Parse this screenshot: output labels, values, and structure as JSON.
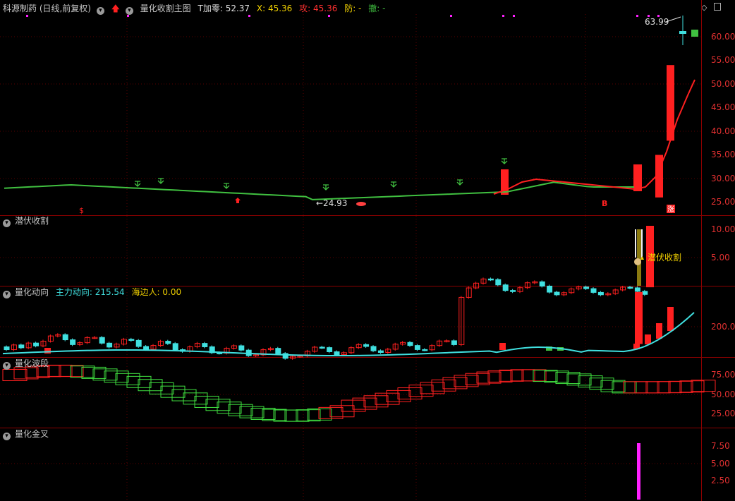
{
  "main_header": {
    "stock": "科源制药 (日线,前复权)",
    "indicator": "量化收割主图",
    "t_label": "T加零: 52.37",
    "x_label": "X: 45.36",
    "gong_label": "攻: 45.36",
    "fang_label": "防: -",
    "che_label": "撤: -"
  },
  "main_annotations": {
    "high_label": "63.99",
    "low_label": "←24.93",
    "mark_s": "$",
    "mark_b": "B",
    "mark_zhang": "涨"
  },
  "main_axis": [
    "60.00",
    "55.00",
    "50.00",
    "45.00",
    "40.00",
    "35.00",
    "30.00",
    "25.00"
  ],
  "qianfu": {
    "title": "潜伏收割",
    "signal_label": "潜伏收割",
    "axis": [
      "10.00",
      "5.00"
    ]
  },
  "dongxiang": {
    "title": "量化动向",
    "main_label": "主力动向: 215.54",
    "side_label": "海边人: 0.00",
    "axis": [
      "200.00"
    ]
  },
  "boduan": {
    "title": "量化波段",
    "axis": [
      "75.00",
      "50.00",
      "25.00"
    ]
  },
  "jincha": {
    "title": "量化金叉",
    "axis": [
      "7.50",
      "5.00",
      "2.50"
    ]
  },
  "colors": {
    "up": "#ff2020",
    "down": "#40e0e0",
    "ma_green": "#40c040",
    "ma_red": "#ff2020",
    "magenta": "#ff20ff",
    "cyan": "#40e0e0",
    "yellow": "#f0d000"
  }
}
